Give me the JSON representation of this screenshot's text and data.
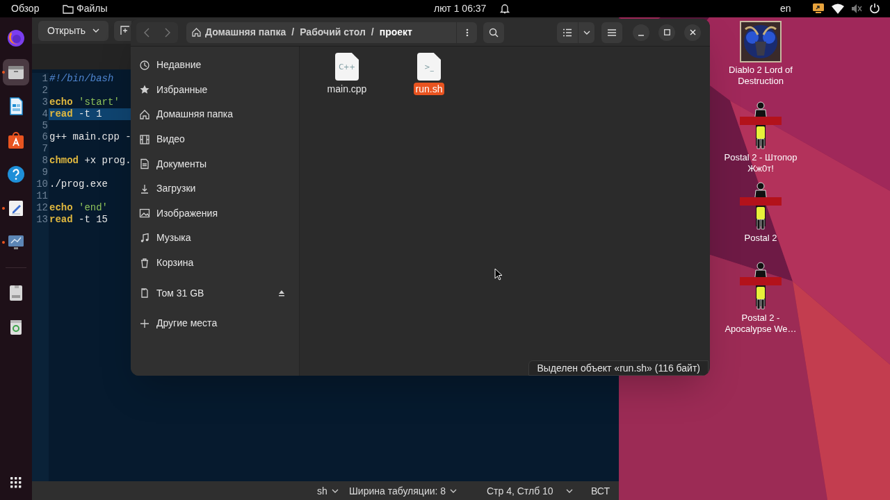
{
  "top_bar": {
    "activities": "Обзор",
    "app": "Файлы",
    "date": "лют 1",
    "time": "06:37",
    "language": "en"
  },
  "dock": {
    "items": [
      {
        "kind": "browser",
        "selected": false,
        "running": false
      },
      {
        "kind": "files",
        "selected": true,
        "running": true
      },
      {
        "kind": "writer",
        "selected": false,
        "running": false
      },
      {
        "kind": "store",
        "selected": false,
        "running": false
      },
      {
        "kind": "help",
        "selected": false,
        "running": false
      },
      {
        "kind": "editor",
        "selected": false,
        "running": true
      },
      {
        "kind": "monitor",
        "selected": false,
        "running": true
      },
      {
        "kind": "drive",
        "selected": false,
        "running": false
      },
      {
        "kind": "trash",
        "selected": false,
        "running": false
      }
    ]
  },
  "editor": {
    "open_button": "Открыть",
    "lines": [
      {
        "number": "1",
        "current": false,
        "tokens": [
          {
            "kind": "comment",
            "text": "#!/bin/bash"
          }
        ]
      },
      {
        "number": "2",
        "current": false
      },
      {
        "number": "3",
        "current": false,
        "tokens": [
          {
            "kind": "keyword",
            "text": "echo"
          },
          {
            "kind": "string",
            "text": " 'start'"
          }
        ]
      },
      {
        "number": "4",
        "current": true,
        "tokens": [
          {
            "kind": "keyword",
            "text": "read"
          },
          {
            "kind": "plain",
            "text": " -t 1"
          }
        ]
      },
      {
        "number": "5",
        "current": false
      },
      {
        "number": "6",
        "current": false,
        "tokens": [
          {
            "kind": "plain",
            "text": "g++ main.cpp -"
          }
        ]
      },
      {
        "number": "7",
        "current": false
      },
      {
        "number": "8",
        "current": false,
        "tokens": [
          {
            "kind": "keyword",
            "text": "chmod"
          },
          {
            "kind": "plain",
            "text": " +x prog."
          }
        ]
      },
      {
        "number": "9",
        "current": false
      },
      {
        "number": "10",
        "current": false,
        "tokens": [
          {
            "kind": "plain",
            "text": "./prog.exe"
          }
        ]
      },
      {
        "number": "11",
        "current": false
      },
      {
        "number": "12",
        "current": false,
        "tokens": [
          {
            "kind": "keyword",
            "text": "echo"
          },
          {
            "kind": "string",
            "text": " 'end'"
          }
        ]
      },
      {
        "number": "13",
        "current": false,
        "tokens": [
          {
            "kind": "keyword",
            "text": "read"
          },
          {
            "kind": "plain",
            "text": " -t 15"
          }
        ]
      }
    ],
    "status_bar": {
      "language": "sh",
      "tab_width": "Ширина табуляции: 8",
      "position": "Стр 4, Стлб 10",
      "mode": "ВСТ"
    }
  },
  "file_manager": {
    "path": [
      {
        "kind": "home",
        "label": "Домашняя папка"
      },
      {
        "kind": "separator",
        "label": "/"
      },
      {
        "kind": "folder",
        "label": "Рабочий стол"
      },
      {
        "kind": "separator",
        "label": "/"
      },
      {
        "kind": "current",
        "label": "проект"
      }
    ],
    "sidebar": {
      "items": [
        {
          "kind": "recent",
          "label": "Недавние"
        },
        {
          "kind": "starred",
          "label": "Избранные"
        },
        {
          "kind": "home",
          "label": "Домашняя папка"
        },
        {
          "kind": "video",
          "label": "Видео"
        },
        {
          "kind": "documents",
          "label": "Документы"
        },
        {
          "kind": "downloads",
          "label": "Загрузки"
        },
        {
          "kind": "pictures",
          "label": "Изображения"
        },
        {
          "kind": "music",
          "label": "Музыка"
        },
        {
          "kind": "trash",
          "label": "Корзина"
        },
        {
          "kind": "drive",
          "label": "Том 31 GB"
        },
        {
          "kind": "other",
          "label": "Другие места"
        }
      ]
    },
    "files": [
      {
        "name": "main.cpp",
        "icon_text": "C++",
        "selected": false
      },
      {
        "name": "run.sh",
        "icon_text": ">_",
        "selected": true
      }
    ],
    "status": "Выделен объект «run.sh»  (116 байт)"
  },
  "desktop_icons": [
    {
      "kind": "medallion",
      "label": "Diablo 2 Lord of Destruction"
    },
    {
      "kind": "figure",
      "label": "Postal 2 - Штопор Жж0т!"
    },
    {
      "kind": "figure",
      "label": "Postal 2"
    },
    {
      "kind": "figure",
      "label": "Postal 2 - Apocalypse We…"
    }
  ]
}
